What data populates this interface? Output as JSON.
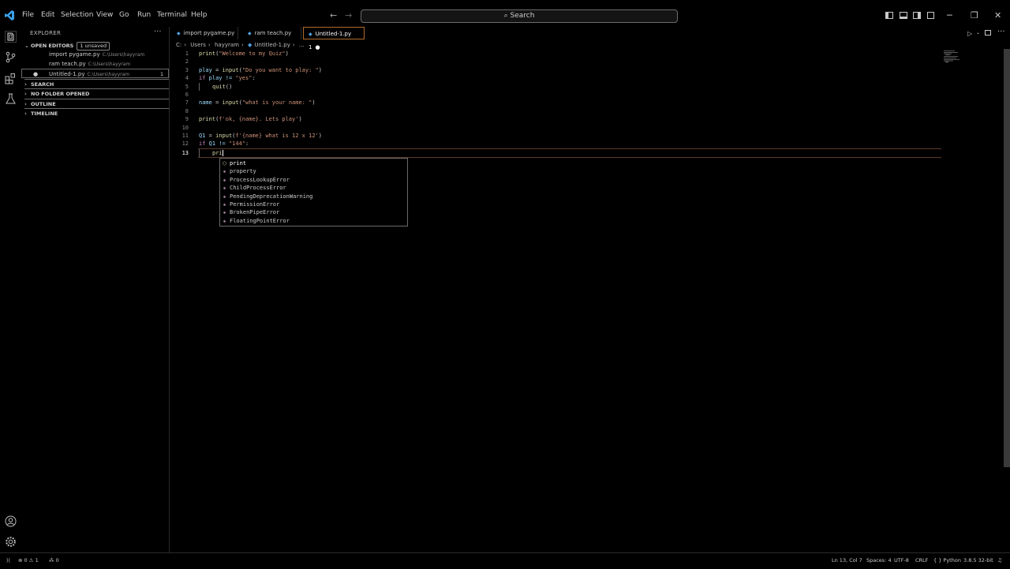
{
  "menu": [
    "File",
    "Edit",
    "Selection",
    "View",
    "Go",
    "Run",
    "Terminal",
    "Help"
  ],
  "search": {
    "label": "Search"
  },
  "sidebar": {
    "title": "EXPLORER",
    "open_editors": {
      "label": "OPEN EDITORS",
      "badge": "1 unsaved"
    },
    "files": [
      {
        "name": "import pygame.py",
        "path": "C:\\Users\\hayyram"
      },
      {
        "name": "ram teach.py",
        "path": "C:\\Users\\hayyram"
      },
      {
        "name": "Untitled-1.py",
        "path": "C:\\Users\\hayyram",
        "badge": "1"
      }
    ],
    "sections": [
      "SEARCH",
      "NO FOLDER OPENED",
      "OUTLINE",
      "TIMELINE"
    ]
  },
  "tabs": [
    {
      "label": "import pygame.py"
    },
    {
      "label": "ram teach.py"
    },
    {
      "label": "Untitled-1.py",
      "badge": "1"
    }
  ],
  "breadcrumb": [
    "C:",
    "Users",
    "hayyram",
    "Untitled-1.py",
    "..."
  ],
  "code": {
    "line_numbers": [
      "1",
      "2",
      "3",
      "4",
      "5",
      "6",
      "7",
      "8",
      "9",
      "10",
      "11",
      "12",
      "13"
    ],
    "l1a": "print",
    "l1b": "(",
    "l1c": "\"Welcome to my Quiz\"",
    "l1d": ")",
    "l3a": "play",
    "l3b": " = ",
    "l3c": "input",
    "l3d": "(",
    "l3e": "\"Do you want to play: \"",
    "l3f": ")",
    "l4a": "if",
    "l4b": " play != ",
    "l4c": "\"yes\"",
    "l4d": ":",
    "l5a": "quit",
    "l5b": "()",
    "l7a": "name",
    "l7b": " = ",
    "l7c": "input",
    "l7d": "(",
    "l7e": "\"what is your name: \"",
    "l7f": ")",
    "l9a": "print",
    "l9b": "(",
    "l9c": "f'ok, {name}. Lets play'",
    "l9d": ")",
    "l11a": "Q1",
    "l11b": " = ",
    "l11c": "input",
    "l11d": "(",
    "l11e": "f'{name} what is 12 x 12'",
    "l11f": ")",
    "l12a": "if",
    "l12b": " Q1 != ",
    "l12c": "\"144\"",
    "l12d": ":",
    "l13a": "pri"
  },
  "suggestions": [
    "print",
    "property",
    "ProcessLookupError",
    "ChildProcessError",
    "PendingDeprecationWarning",
    "PermissionError",
    "BrokenPipeError",
    "FloatingPointError"
  ],
  "status": {
    "problems": "⊗ 0 ⚠ 1",
    "ports": "⁂ 0",
    "cursor": "Ln 13, Col 7",
    "spaces": "Spaces: 4",
    "encoding": "UTF-8",
    "eol": "CRLF",
    "language": "{ } Python",
    "interpreter": "3.8.5 32-bit"
  },
  "colors": {
    "accent_tab": "#b06a2a",
    "keyword": "#c586c0",
    "string": "#ce9178",
    "function": "#dcdcaa",
    "python_icon": "#4ea0e0"
  }
}
